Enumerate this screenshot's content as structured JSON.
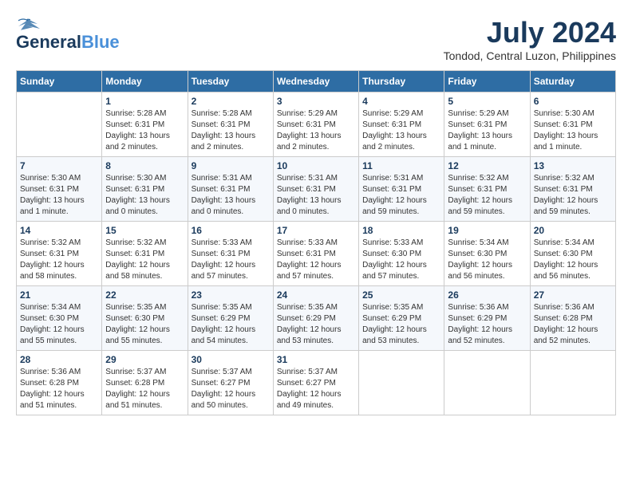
{
  "header": {
    "logo_line1": "General",
    "logo_line2": "Blue",
    "month_year": "July 2024",
    "location": "Tondod, Central Luzon, Philippines"
  },
  "days_of_week": [
    "Sunday",
    "Monday",
    "Tuesday",
    "Wednesday",
    "Thursday",
    "Friday",
    "Saturday"
  ],
  "weeks": [
    [
      {
        "day": "",
        "info": ""
      },
      {
        "day": "1",
        "info": "Sunrise: 5:28 AM\nSunset: 6:31 PM\nDaylight: 13 hours\nand 2 minutes."
      },
      {
        "day": "2",
        "info": "Sunrise: 5:28 AM\nSunset: 6:31 PM\nDaylight: 13 hours\nand 2 minutes."
      },
      {
        "day": "3",
        "info": "Sunrise: 5:29 AM\nSunset: 6:31 PM\nDaylight: 13 hours\nand 2 minutes."
      },
      {
        "day": "4",
        "info": "Sunrise: 5:29 AM\nSunset: 6:31 PM\nDaylight: 13 hours\nand 2 minutes."
      },
      {
        "day": "5",
        "info": "Sunrise: 5:29 AM\nSunset: 6:31 PM\nDaylight: 13 hours\nand 1 minute."
      },
      {
        "day": "6",
        "info": "Sunrise: 5:30 AM\nSunset: 6:31 PM\nDaylight: 13 hours\nand 1 minute."
      }
    ],
    [
      {
        "day": "7",
        "info": "Sunrise: 5:30 AM\nSunset: 6:31 PM\nDaylight: 13 hours\nand 1 minute."
      },
      {
        "day": "8",
        "info": "Sunrise: 5:30 AM\nSunset: 6:31 PM\nDaylight: 13 hours\nand 0 minutes."
      },
      {
        "day": "9",
        "info": "Sunrise: 5:31 AM\nSunset: 6:31 PM\nDaylight: 13 hours\nand 0 minutes."
      },
      {
        "day": "10",
        "info": "Sunrise: 5:31 AM\nSunset: 6:31 PM\nDaylight: 13 hours\nand 0 minutes."
      },
      {
        "day": "11",
        "info": "Sunrise: 5:31 AM\nSunset: 6:31 PM\nDaylight: 12 hours\nand 59 minutes."
      },
      {
        "day": "12",
        "info": "Sunrise: 5:32 AM\nSunset: 6:31 PM\nDaylight: 12 hours\nand 59 minutes."
      },
      {
        "day": "13",
        "info": "Sunrise: 5:32 AM\nSunset: 6:31 PM\nDaylight: 12 hours\nand 59 minutes."
      }
    ],
    [
      {
        "day": "14",
        "info": "Sunrise: 5:32 AM\nSunset: 6:31 PM\nDaylight: 12 hours\nand 58 minutes."
      },
      {
        "day": "15",
        "info": "Sunrise: 5:32 AM\nSunset: 6:31 PM\nDaylight: 12 hours\nand 58 minutes."
      },
      {
        "day": "16",
        "info": "Sunrise: 5:33 AM\nSunset: 6:31 PM\nDaylight: 12 hours\nand 57 minutes."
      },
      {
        "day": "17",
        "info": "Sunrise: 5:33 AM\nSunset: 6:31 PM\nDaylight: 12 hours\nand 57 minutes."
      },
      {
        "day": "18",
        "info": "Sunrise: 5:33 AM\nSunset: 6:30 PM\nDaylight: 12 hours\nand 57 minutes."
      },
      {
        "day": "19",
        "info": "Sunrise: 5:34 AM\nSunset: 6:30 PM\nDaylight: 12 hours\nand 56 minutes."
      },
      {
        "day": "20",
        "info": "Sunrise: 5:34 AM\nSunset: 6:30 PM\nDaylight: 12 hours\nand 56 minutes."
      }
    ],
    [
      {
        "day": "21",
        "info": "Sunrise: 5:34 AM\nSunset: 6:30 PM\nDaylight: 12 hours\nand 55 minutes."
      },
      {
        "day": "22",
        "info": "Sunrise: 5:35 AM\nSunset: 6:30 PM\nDaylight: 12 hours\nand 55 minutes."
      },
      {
        "day": "23",
        "info": "Sunrise: 5:35 AM\nSunset: 6:29 PM\nDaylight: 12 hours\nand 54 minutes."
      },
      {
        "day": "24",
        "info": "Sunrise: 5:35 AM\nSunset: 6:29 PM\nDaylight: 12 hours\nand 53 minutes."
      },
      {
        "day": "25",
        "info": "Sunrise: 5:35 AM\nSunset: 6:29 PM\nDaylight: 12 hours\nand 53 minutes."
      },
      {
        "day": "26",
        "info": "Sunrise: 5:36 AM\nSunset: 6:29 PM\nDaylight: 12 hours\nand 52 minutes."
      },
      {
        "day": "27",
        "info": "Sunrise: 5:36 AM\nSunset: 6:28 PM\nDaylight: 12 hours\nand 52 minutes."
      }
    ],
    [
      {
        "day": "28",
        "info": "Sunrise: 5:36 AM\nSunset: 6:28 PM\nDaylight: 12 hours\nand 51 minutes."
      },
      {
        "day": "29",
        "info": "Sunrise: 5:37 AM\nSunset: 6:28 PM\nDaylight: 12 hours\nand 51 minutes."
      },
      {
        "day": "30",
        "info": "Sunrise: 5:37 AM\nSunset: 6:27 PM\nDaylight: 12 hours\nand 50 minutes."
      },
      {
        "day": "31",
        "info": "Sunrise: 5:37 AM\nSunset: 6:27 PM\nDaylight: 12 hours\nand 49 minutes."
      },
      {
        "day": "",
        "info": ""
      },
      {
        "day": "",
        "info": ""
      },
      {
        "day": "",
        "info": ""
      }
    ]
  ]
}
